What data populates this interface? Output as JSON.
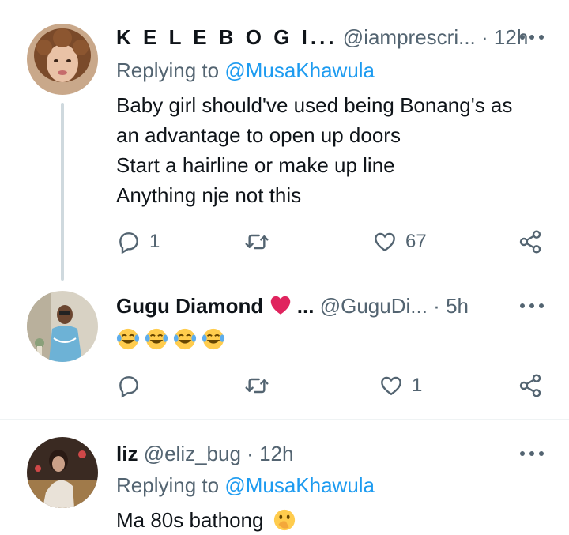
{
  "tweets": [
    {
      "name": "K E L E B O G I...",
      "handle": "@iamprescri...",
      "dot": "·",
      "time": "12h",
      "replying_prefix": "Replying to",
      "replying_to": "@MusaKhawula",
      "lines": [
        "Baby girl should've used being Bonang's as",
        "an advantage to open up doors",
        "Start a hairline or make up line",
        "Anything nje not this"
      ],
      "reply_count": "1",
      "retweet_count": "",
      "like_count": "67"
    },
    {
      "name": "Gugu Diamond",
      "name_suffix": "...",
      "handle": "@GuguDi...",
      "dot": "·",
      "time": "5h",
      "emojis": [
        "face-with-tears-of-joy",
        "face-with-tears-of-joy",
        "face-with-tears-of-joy",
        "face-with-tears-of-joy"
      ],
      "reply_count": "",
      "retweet_count": "",
      "like_count": "1"
    },
    {
      "name": "liz",
      "handle": "@eliz_bug",
      "dot": "·",
      "time": "12h",
      "replying_prefix": "Replying to",
      "replying_to": "@MusaKhawula",
      "text": "Ma 80s bathong",
      "trailing_emoji": "face-with-hand-over-mouth"
    }
  ],
  "icons": {
    "reply": "reply-icon",
    "retweet": "retweet-icon",
    "like": "heart-icon",
    "share": "share-icon",
    "more": "more-icon",
    "heart_emoji": "red-heart-icon"
  },
  "colors": {
    "text": "#0f1419",
    "secondary": "#536471",
    "link": "#1d9bf0",
    "thread_line": "#cfd9de",
    "divider": "#eff3f4",
    "heart": "#e0245e"
  }
}
